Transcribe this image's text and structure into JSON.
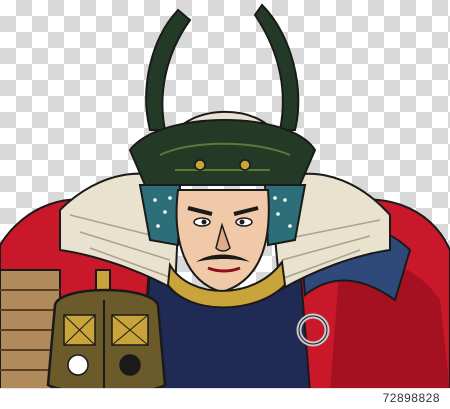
{
  "image": {
    "id_text": "72898828"
  },
  "colors": {
    "armor_red": "#c8182a",
    "armor_red_dark": "#8e0d1c",
    "navy": "#1f2a55",
    "helmet_dark_green": "#233a27",
    "helmet_gold": "#c9a43a",
    "hair_white": "#e8e2cf",
    "skin": "#f0c9a8",
    "outline": "#1a1a1a"
  }
}
